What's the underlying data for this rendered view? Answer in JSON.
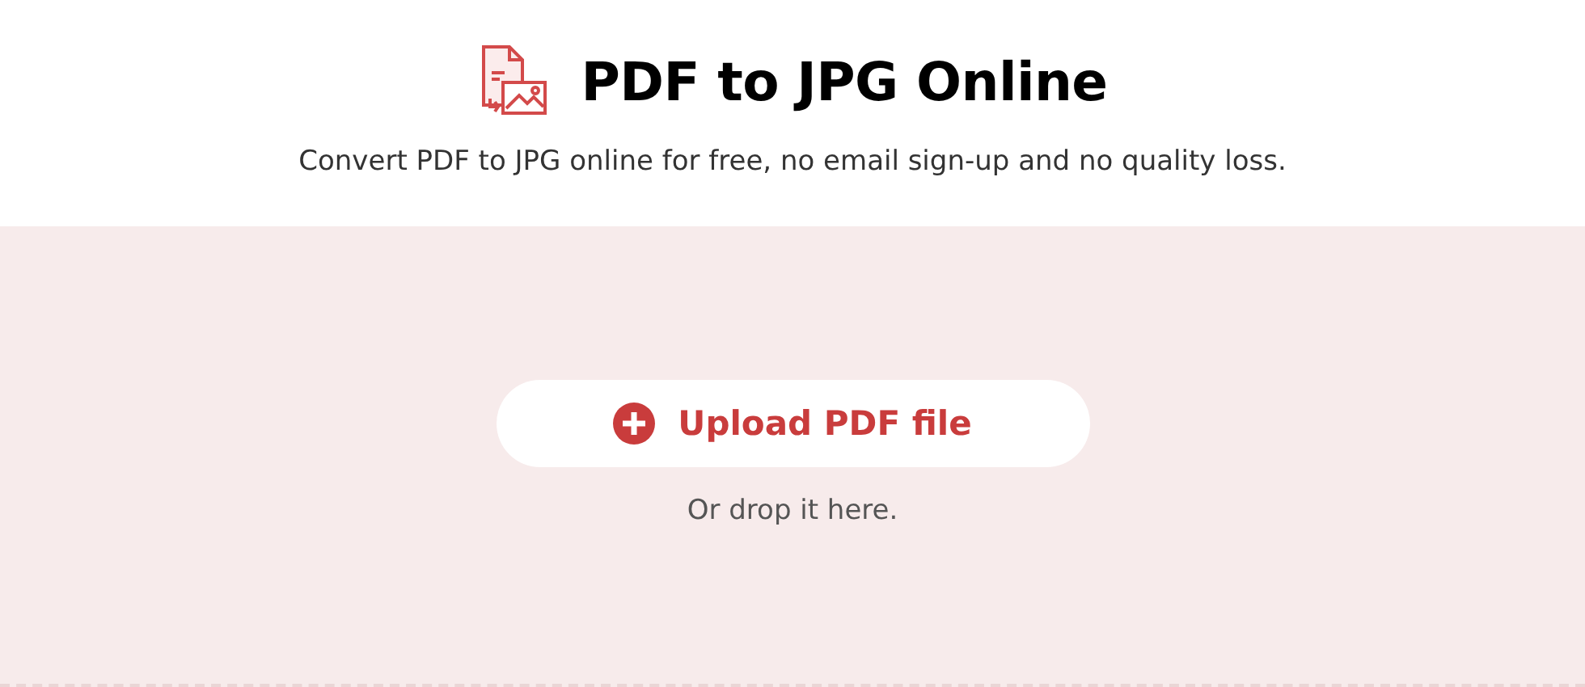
{
  "header": {
    "title": "PDF to JPG Online",
    "subtitle": "Convert PDF to JPG online for free, no email sign-up and no quality loss."
  },
  "dropzone": {
    "button": "Upload PDF file",
    "hint": "Or drop it here."
  }
}
